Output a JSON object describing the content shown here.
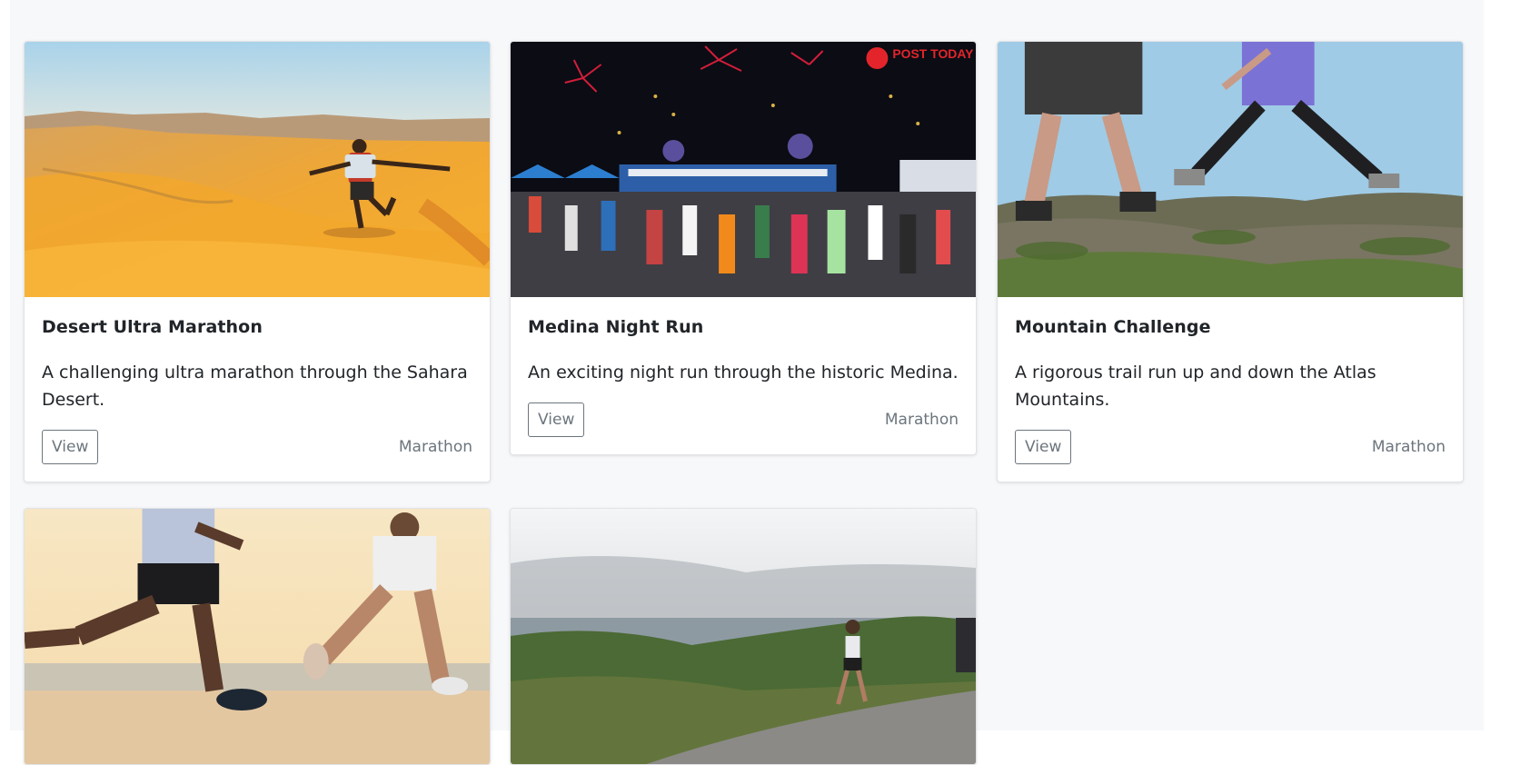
{
  "cards": [
    {
      "image_alt": "Runner in the Sahara desert dunes",
      "title": "Desert Ultra Marathon",
      "description": "A challenging ultra marathon through the Sahara Desert.",
      "button_label": "View",
      "category": "Marathon"
    },
    {
      "image_alt": "Crowd of runners at night with fireworks",
      "image_watermark": "POST TODAY",
      "title": "Medina Night Run",
      "description": "An exciting night run through the historic Medina.",
      "button_label": "View",
      "category": "Marathon"
    },
    {
      "image_alt": "Trail runners on rocky mountain terrain",
      "title": "Mountain Challenge",
      "description": "A rigorous trail run up and down the Atlas Mountains.",
      "button_label": "View",
      "category": "Marathon"
    },
    {
      "image_alt": "Two runners on a beach at sunset"
    },
    {
      "image_alt": "Runners on a coastal road"
    }
  ],
  "colors": {
    "page_bg": "#f7f8fa",
    "card_border": "#e1e3e6",
    "text": "#212529",
    "muted": "#6c757d"
  }
}
